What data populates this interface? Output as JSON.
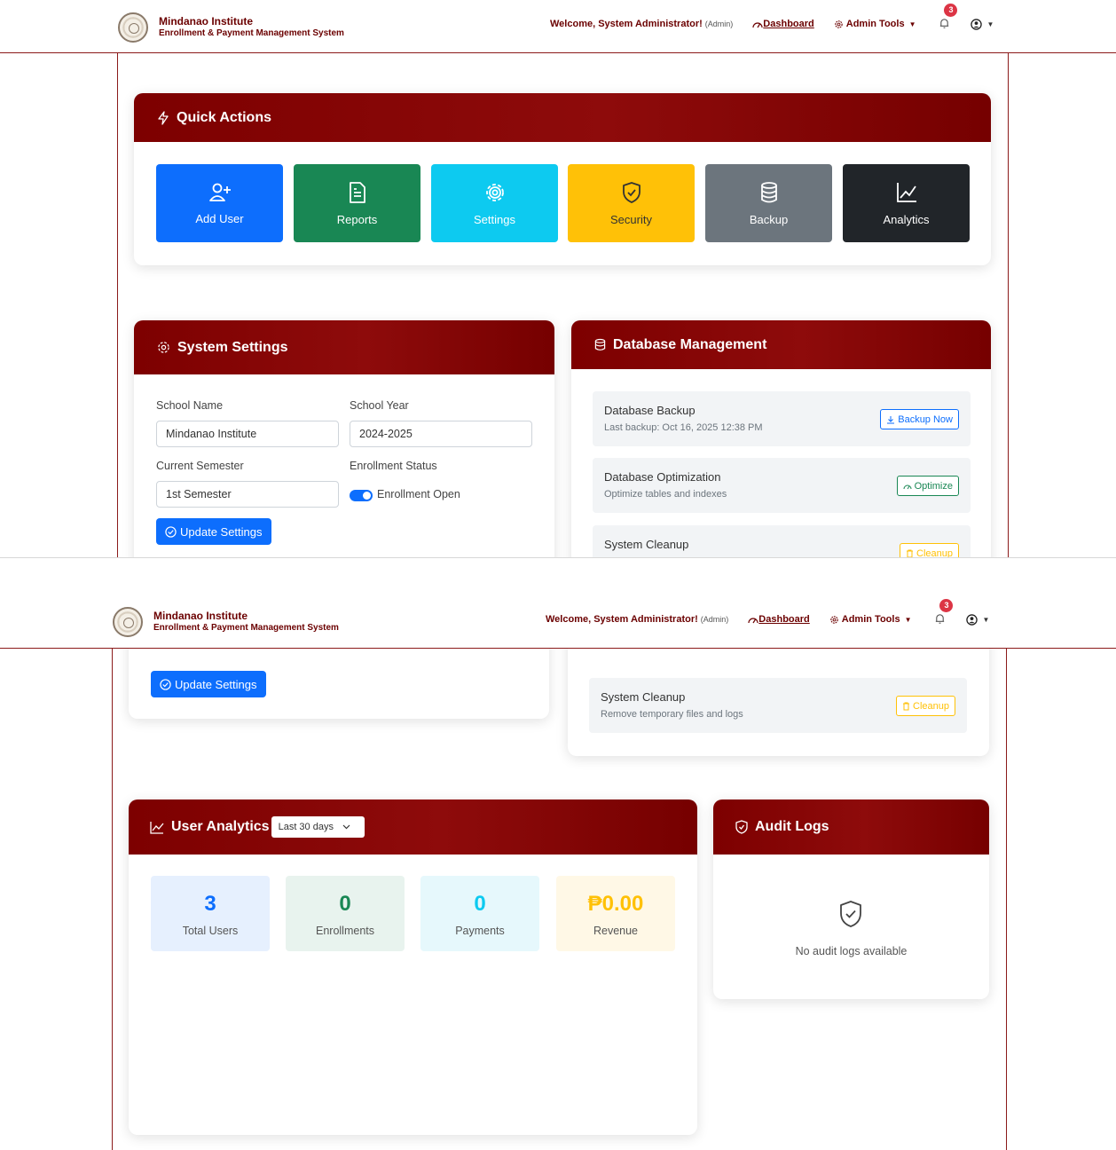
{
  "navbar": {
    "brand_title": "Mindanao Institute",
    "brand_subtitle": "Enrollment & Payment Management System",
    "welcome": "Welcome, System Administrator!",
    "role": "(Admin)",
    "dashboard_link": "Dashboard",
    "admin_tools": "Admin Tools",
    "notification_count": "3"
  },
  "quick_actions": {
    "title": "Quick Actions",
    "buttons": [
      {
        "label": "Add User",
        "color": "#0d6efd",
        "icon": "user-plus-icon"
      },
      {
        "label": "Reports",
        "color": "#198754",
        "icon": "file-text-icon"
      },
      {
        "label": "Settings",
        "color": "#0dcaf0",
        "icon": "gear-icon"
      },
      {
        "label": "Security",
        "color": "#ffc107",
        "icon": "shield-check-icon"
      },
      {
        "label": "Backup",
        "color": "#6c757d",
        "icon": "database-icon"
      },
      {
        "label": "Analytics",
        "color": "#212529",
        "icon": "chart-line-icon"
      }
    ]
  },
  "system_settings": {
    "title": "System Settings",
    "school_name_label": "School Name",
    "school_name_value": "Mindanao Institute",
    "school_year_label": "School Year",
    "school_year_value": "2024-2025",
    "semester_label": "Current Semester",
    "semester_value": "1st Semester",
    "enrollment_status_label": "Enrollment Status",
    "enrollment_toggle_label": "Enrollment Open",
    "update_button": "Update Settings"
  },
  "database_management": {
    "title": "Database Management",
    "rows": [
      {
        "title": "Database Backup",
        "subtitle": "Last backup: Oct 16, 2025 12:38 PM",
        "button": "Backup Now",
        "color": "#0d6efd"
      },
      {
        "title": "Database Optimization",
        "subtitle": "Optimize tables and indexes",
        "button": "Optimize",
        "color": "#198754"
      },
      {
        "title": "System Cleanup",
        "subtitle": "Remove temporary files and logs",
        "button": "Cleanup",
        "color": "#ffc107"
      }
    ]
  },
  "user_analytics": {
    "title": "User Analytics",
    "range_select": "Last 30 days",
    "stats": [
      {
        "value": "3",
        "label": "Total Users",
        "color": "#0d6efd",
        "bg": "#e6f0fe"
      },
      {
        "value": "0",
        "label": "Enrollments",
        "color": "#198754",
        "bg": "#e8f3ee"
      },
      {
        "value": "0",
        "label": "Payments",
        "color": "#0dcaf0",
        "bg": "#e6f8fc"
      },
      {
        "value": "₱0.00",
        "label": "Revenue",
        "color": "#ffc107",
        "bg": "#fff8e6"
      }
    ]
  },
  "audit_logs": {
    "title": "Audit Logs",
    "empty_text": "No audit logs available"
  }
}
